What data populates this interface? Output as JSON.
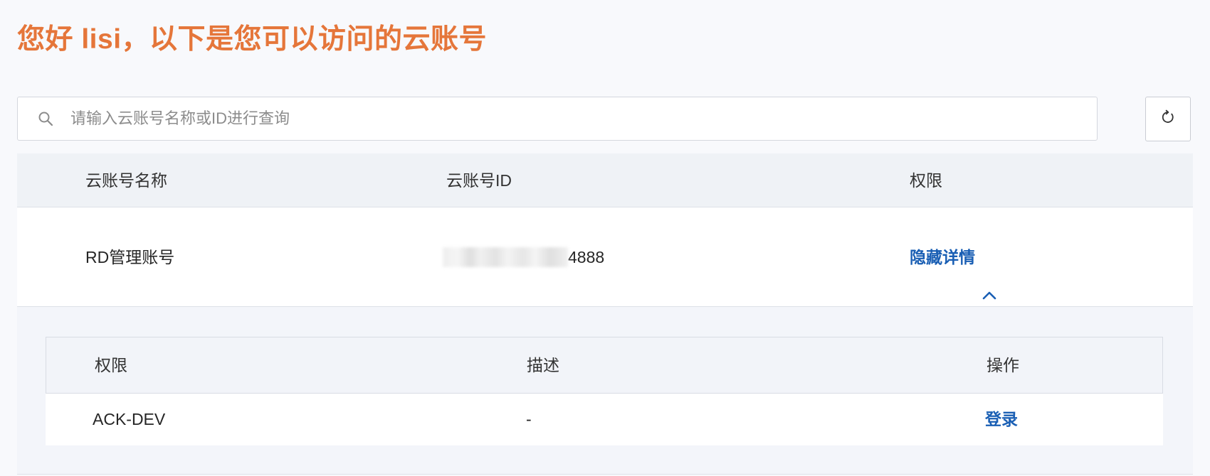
{
  "greeting": "您好 lisi，以下是您可以访问的云账号",
  "search": {
    "placeholder": "请输入云账号名称或ID进行查询",
    "value": ""
  },
  "icons": {
    "search": "search-icon",
    "refresh": "refresh-icon",
    "toggle": "chevron-up-icon"
  },
  "table": {
    "columns": [
      "云账号名称",
      "云账号ID",
      "权限"
    ],
    "rows": [
      {
        "name": "RD管理账号",
        "id_visible_suffix": "4888",
        "permission_toggle": "隐藏详情"
      }
    ]
  },
  "detail": {
    "columns": [
      "权限",
      "描述",
      "操作"
    ],
    "rows": [
      {
        "permission": "ACK-DEV",
        "description": "-",
        "action": "登录"
      }
    ]
  },
  "colors": {
    "greeting": "#e5763a",
    "link": "#1a5fb4",
    "header_bg": "#eff2f6"
  }
}
